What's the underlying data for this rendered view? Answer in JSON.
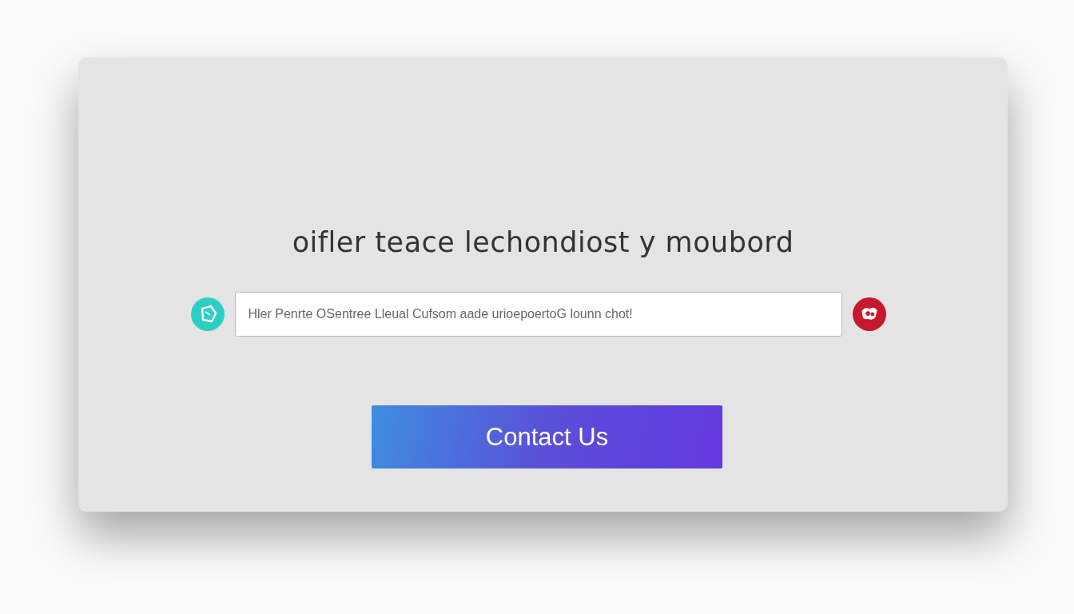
{
  "heading": "oifler teace lechondiost y moubord",
  "message_field": {
    "placeholder": "Hler Penrte OSentree Lleual Cufsom aade urioepoertoG lounn chot!"
  },
  "contact_button": {
    "label": "Contact Us"
  }
}
